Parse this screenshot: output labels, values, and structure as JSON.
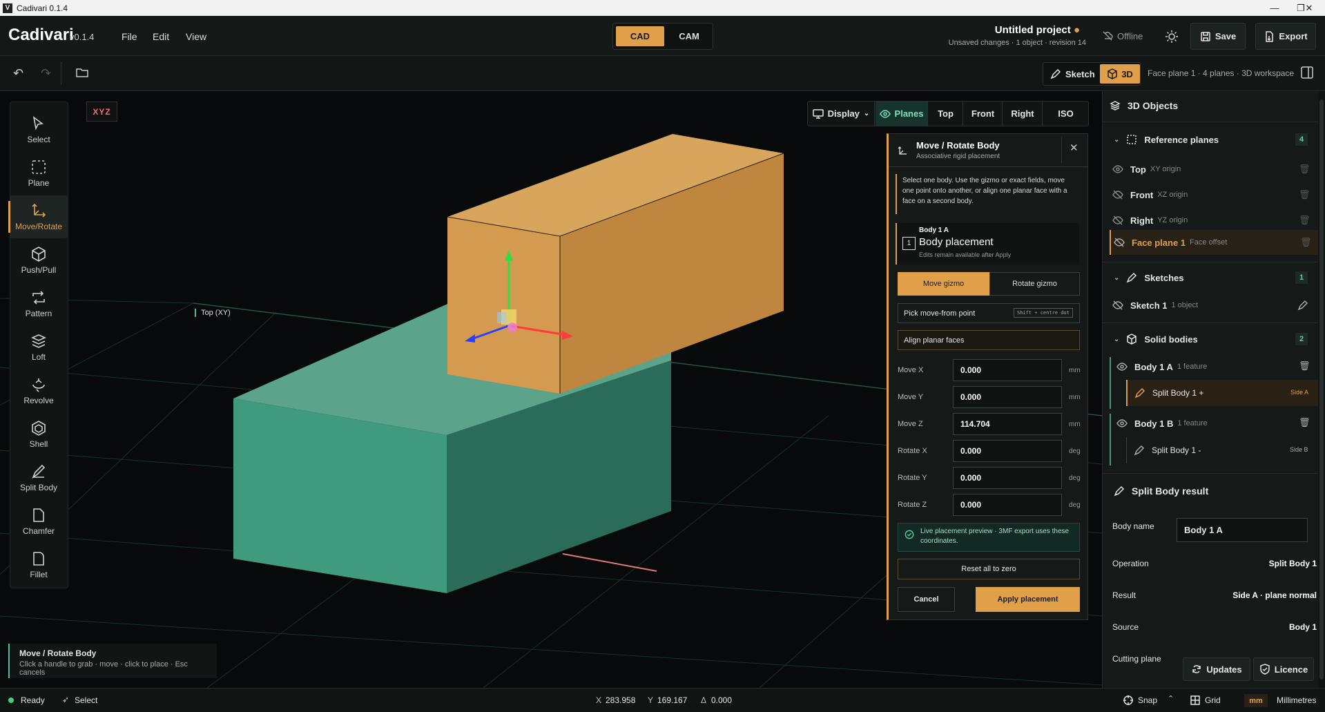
{
  "window": {
    "title": "Cadivari 0.1.4",
    "logo": "V",
    "controls": [
      "minimize-icon",
      "maximize-icon",
      "close-icon"
    ]
  },
  "app": {
    "name": "Cadivari",
    "version": "v0.1.4",
    "menus": [
      "File",
      "Edit",
      "View"
    ]
  },
  "modes": {
    "cad": "CAD",
    "cam": "CAM"
  },
  "project": {
    "title": "Untitled project",
    "subtitle": "Unsaved changes · 1 object · revision 14"
  },
  "header": {
    "offline": "Offline",
    "save": "Save",
    "export": "Export"
  },
  "subtoolbar": {
    "sketch": "Sketch",
    "three_d": "3D",
    "context": "Face plane 1 · 4 planes · 3D workspace"
  },
  "tools": [
    {
      "label": "Select",
      "icon": "cursor-icon"
    },
    {
      "label": "Plane",
      "icon": "plane-dashed-icon"
    },
    {
      "label": "Move/Rotate",
      "icon": "move-axes-icon",
      "active": true
    },
    {
      "label": "Push/Pull",
      "icon": "cube-icon"
    },
    {
      "label": "Pattern",
      "icon": "pattern-icon"
    },
    {
      "label": "Loft",
      "icon": "layers-icon"
    },
    {
      "label": "Revolve",
      "icon": "revolve-icon"
    },
    {
      "label": "Shell",
      "icon": "shell-icon"
    },
    {
      "label": "Split Body",
      "icon": "split-icon"
    },
    {
      "label": "Chamfer",
      "icon": "chamfer-icon"
    },
    {
      "label": "Fillet",
      "icon": "fillet-icon"
    }
  ],
  "viewport": {
    "axes_badge": "XYZ",
    "plane_label": "Top (XY)",
    "view_buttons": {
      "display": "Display",
      "planes": "Planes",
      "top": "Top",
      "front": "Front",
      "right": "Right",
      "iso": "ISO"
    },
    "hint_title": "Move / Rotate Body",
    "hint_text": "Click a handle to grab · move · click to place · Esc cancels"
  },
  "dialog": {
    "title": "Move / Rotate Body",
    "subtitle": "Associative rigid placement",
    "info": "Select one body. Use the gizmo or exact fields, move one point onto another, or align one planar face with a face on a second body.",
    "body_tag": "Body 1 A",
    "body_index": "1",
    "body_heading": "Body placement",
    "body_note": "Edits remain available after Apply",
    "move_gizmo": "Move gizmo",
    "rotate_gizmo": "Rotate gizmo",
    "pick_point": "Pick move-from point",
    "pick_shortcut": "Shift + centre dot",
    "align_faces": "Align planar faces",
    "fields": [
      {
        "label": "Move X",
        "value": "0.000",
        "unit": "mm"
      },
      {
        "label": "Move Y",
        "value": "0.000",
        "unit": "mm"
      },
      {
        "label": "Move Z",
        "value": "114.704",
        "unit": "mm"
      },
      {
        "label": "Rotate X",
        "value": "0.000",
        "unit": "deg"
      },
      {
        "label": "Rotate Y",
        "value": "0.000",
        "unit": "deg"
      },
      {
        "label": "Rotate Z",
        "value": "0.000",
        "unit": "deg"
      }
    ],
    "preview_note": "Live placement preview · 3MF export uses these coordinates.",
    "reset": "Reset all to zero",
    "cancel": "Cancel",
    "apply": "Apply placement"
  },
  "panel": {
    "title": "3D Objects",
    "reference_planes": {
      "label": "Reference planes",
      "count": "4",
      "items": [
        {
          "name": "Top",
          "meta": "XY origin"
        },
        {
          "name": "Front",
          "meta": "XZ origin"
        },
        {
          "name": "Right",
          "meta": "YZ origin"
        },
        {
          "name": "Face plane 1",
          "meta": "Face offset"
        }
      ]
    },
    "sketches": {
      "label": "Sketches",
      "count": "1",
      "items": [
        {
          "name": "Sketch 1",
          "meta": "1 object"
        }
      ]
    },
    "solid_bodies": {
      "label": "Solid bodies",
      "count": "2",
      "items": [
        {
          "name": "Body 1 A",
          "meta": "1 feature",
          "feature": "Split Body 1 +",
          "side": "Side A"
        },
        {
          "name": "Body 1 B",
          "meta": "1 feature",
          "feature": "Split Body 1 -",
          "side": "Side B"
        }
      ]
    },
    "result": {
      "title": "Split Body result",
      "body_name_label": "Body name",
      "body_name_value": "Body 1 A",
      "operation_label": "Operation",
      "operation_value": "Split Body 1",
      "result_label": "Result",
      "result_value": "Side A · plane normal",
      "source_label": "Source",
      "source_value": "Body 1",
      "cutting_label": "Cutting plane"
    },
    "updates": "Updates",
    "licence": "Licence"
  },
  "status": {
    "ready": "Ready",
    "mode": "Select",
    "x_label": "X",
    "x_value": "283.958",
    "y_label": "Y",
    "y_value": "169.167",
    "d_label": "Δ",
    "d_value": "0.000",
    "snap": "Snap",
    "grid": "Grid",
    "unit_badge": "mm",
    "units": "Millimetres"
  },
  "colors": {
    "accent": "#e0a04a",
    "body_a": "#d49a4f",
    "body_b": "#3f9a7e",
    "background": "#07090a"
  }
}
